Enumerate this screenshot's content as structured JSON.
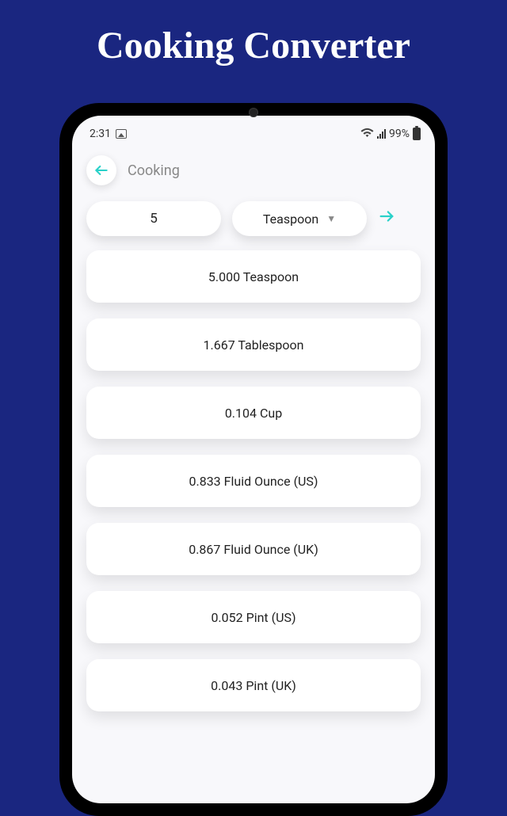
{
  "page": {
    "title": "Cooking Converter"
  },
  "status": {
    "time": "2:31",
    "battery_pct": "99%"
  },
  "header": {
    "title": "Cooking"
  },
  "input": {
    "value": "5",
    "unit": "Teaspoon"
  },
  "results": [
    "5.000 Teaspoon",
    "1.667 Tablespoon",
    "0.104 Cup",
    "0.833 Fluid Ounce (US)",
    "0.867 Fluid Ounce (UK)",
    "0.052 Pint (US)",
    "0.043 Pint (UK)"
  ]
}
